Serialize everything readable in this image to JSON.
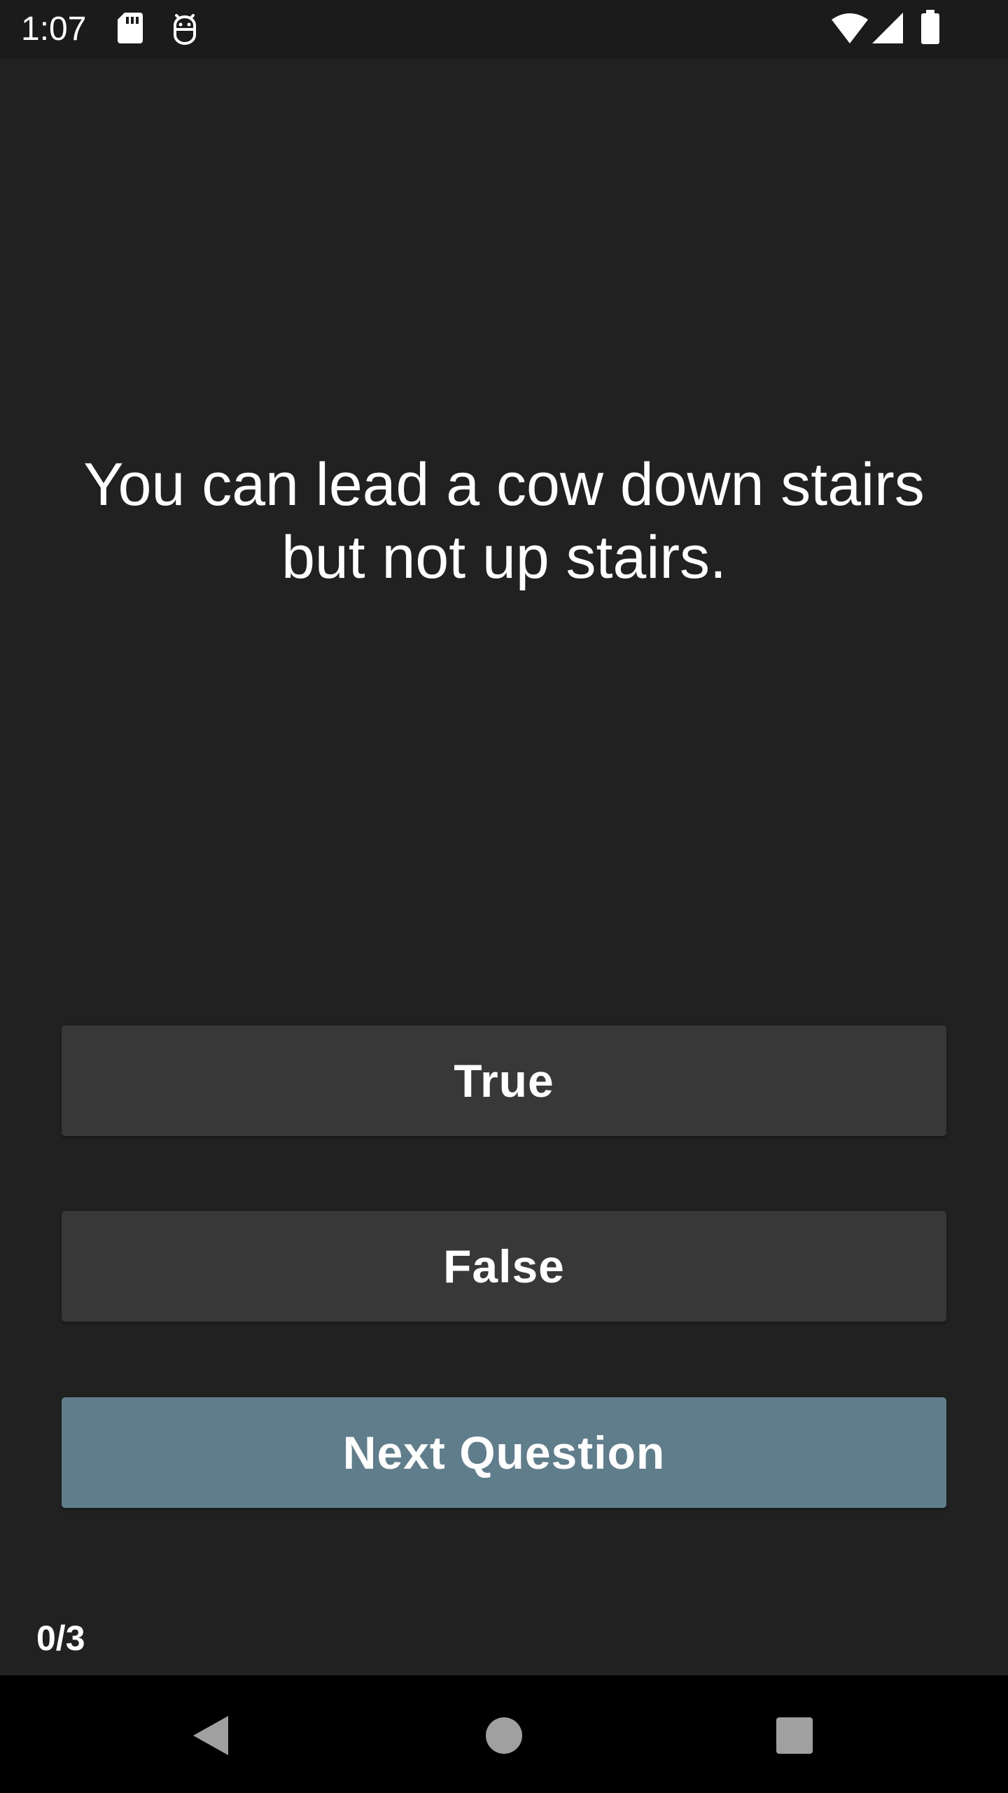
{
  "status_bar": {
    "time": "1:07",
    "icons": [
      "sd-card-icon",
      "debug-icon",
      "wifi-icon",
      "signal-icon",
      "battery-icon"
    ]
  },
  "quiz": {
    "question": "You can lead a cow down stairs but not up stairs.",
    "true_label": "True",
    "false_label": "False",
    "next_label": "Next Question",
    "score": "0/3"
  },
  "colors": {
    "background": "#212121",
    "answer_button": "#383838",
    "next_button": "#607d8b",
    "text": "#ffffff"
  },
  "nav_bar": {
    "icons": [
      "back-icon",
      "home-icon",
      "recents-icon"
    ]
  }
}
